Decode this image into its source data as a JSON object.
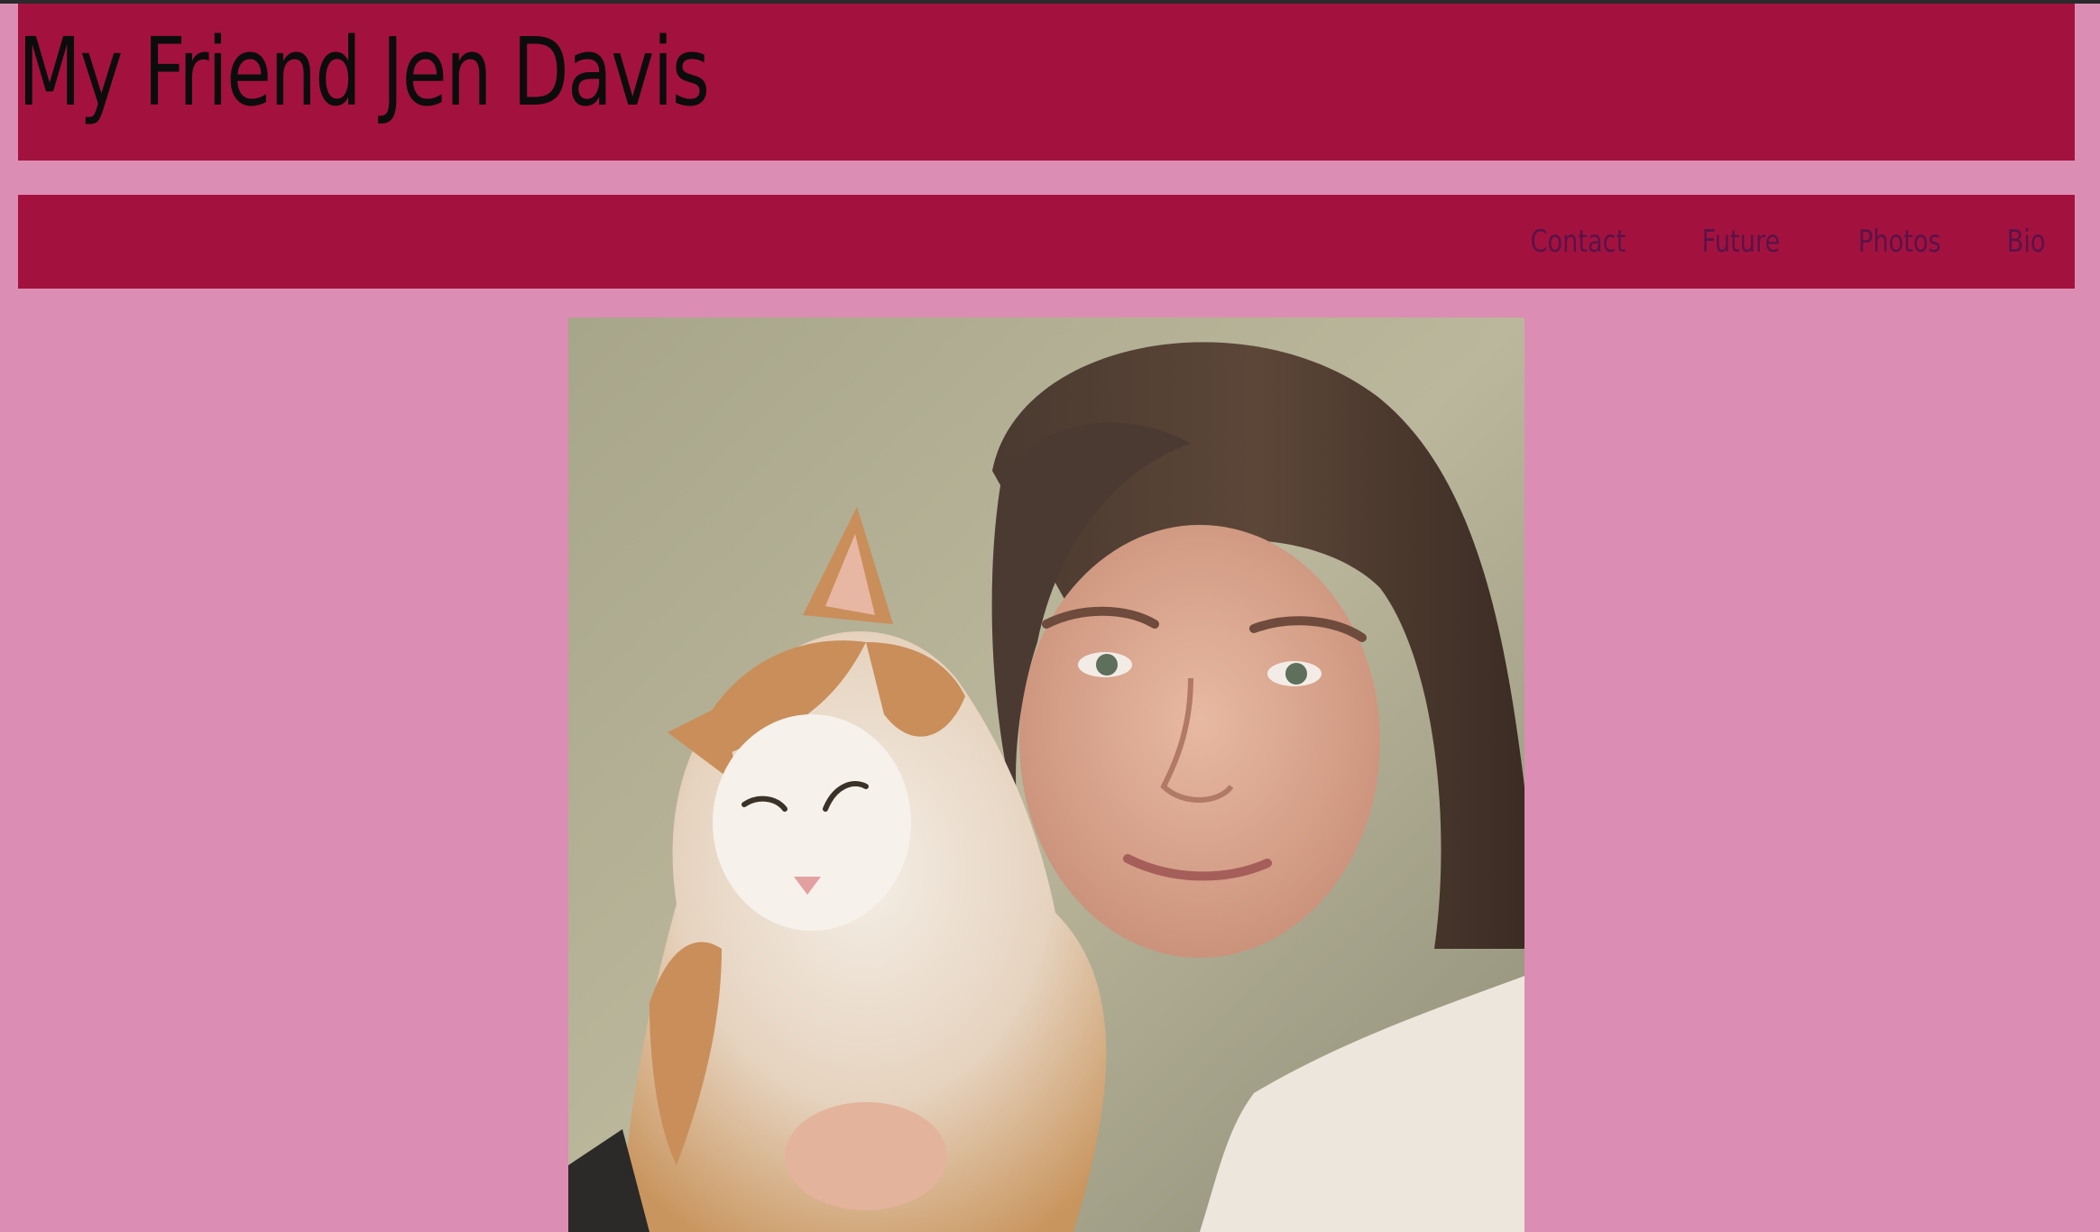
{
  "header": {
    "title": "My Friend Jen Davis"
  },
  "nav": {
    "items": [
      {
        "label": "Contact"
      },
      {
        "label": "Future"
      },
      {
        "label": "Photos"
      },
      {
        "label": "Bio"
      }
    ]
  },
  "colors": {
    "page_background": "#dc8db4",
    "banner": "#a3123f",
    "title_text": "#0c0c0c",
    "nav_text": "#5a1248"
  },
  "main": {
    "photo": {
      "description_icon": "photo-of-woman-with-cat"
    }
  }
}
